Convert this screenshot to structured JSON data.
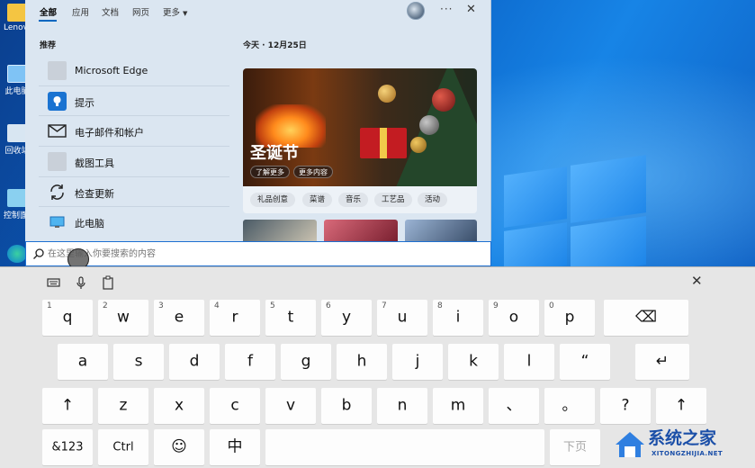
{
  "start": {
    "tabs": [
      {
        "label": "全部",
        "active": true
      },
      {
        "label": "应用"
      },
      {
        "label": "文档"
      },
      {
        "label": "网页"
      },
      {
        "label": "更多"
      }
    ],
    "recommended_title": "推荐",
    "recommended": [
      {
        "label": "Microsoft Edge",
        "icon": "edge-icon"
      },
      {
        "label": "提示",
        "icon": "lightbulb-icon"
      },
      {
        "label": "电子邮件和帐户",
        "icon": "mail-icon"
      },
      {
        "label": "截图工具",
        "icon": "snipping-tool-icon"
      },
      {
        "label": "检查更新",
        "icon": "refresh-icon"
      },
      {
        "label": "此电脑",
        "icon": "computer-icon"
      }
    ],
    "today_label": "今天 · 12月25日",
    "feature": {
      "title": "圣诞节",
      "buttons": [
        "了解更多",
        "更多内容"
      ]
    },
    "tags": [
      "礼品创意",
      "菜谱",
      "音乐",
      "工艺品",
      "活动"
    ]
  },
  "desktop": {
    "icons": [
      {
        "label": "Lenovo",
        "icon": "folder-icon"
      },
      {
        "label": "此电脑",
        "icon": "computer-icon"
      },
      {
        "label": "回收站",
        "icon": "recycle-bin-icon"
      },
      {
        "label": "控制面板",
        "icon": "control-panel-icon"
      },
      {
        "label": "",
        "icon": "edge-icon"
      }
    ]
  },
  "search": {
    "placeholder": "在这里输入你要搜索的内容"
  },
  "keyboard": {
    "rows": [
      [
        {
          "label": "q",
          "sub": "1"
        },
        {
          "label": "w",
          "sub": "2"
        },
        {
          "label": "e",
          "sub": "3"
        },
        {
          "label": "r",
          "sub": "4"
        },
        {
          "label": "t",
          "sub": "5"
        },
        {
          "label": "y",
          "sub": "6"
        },
        {
          "label": "u",
          "sub": "7"
        },
        {
          "label": "i",
          "sub": "8"
        },
        {
          "label": "o",
          "sub": "9"
        },
        {
          "label": "p",
          "sub": "0"
        },
        {
          "label": "⌫",
          "icon": "backspace-icon"
        }
      ],
      [
        {
          "label": "a"
        },
        {
          "label": "s"
        },
        {
          "label": "d"
        },
        {
          "label": "f"
        },
        {
          "label": "g"
        },
        {
          "label": "h"
        },
        {
          "label": "j"
        },
        {
          "label": "k"
        },
        {
          "label": "l"
        },
        {
          "label": "“"
        },
        {
          "label": "↵",
          "icon": "enter-icon"
        }
      ],
      [
        {
          "label": "↑",
          "icon": "shift-icon"
        },
        {
          "label": "z"
        },
        {
          "label": "x"
        },
        {
          "label": "c"
        },
        {
          "label": "v"
        },
        {
          "label": "b"
        },
        {
          "label": "n"
        },
        {
          "label": "m"
        },
        {
          "label": "、"
        },
        {
          "label": "。"
        },
        {
          "label": "?"
        },
        {
          "label": "↑",
          "icon": "shift-icon"
        }
      ],
      [
        {
          "label": "&123"
        },
        {
          "label": "Ctrl"
        },
        {
          "label": "☺",
          "icon": "emoji-icon"
        },
        {
          "label": "中"
        },
        {
          "label": ""
        },
        {
          "label": "下页"
        }
      ]
    ]
  },
  "watermark": {
    "title": "系统之家",
    "subtitle": "XITONGZHIJIA.NET"
  },
  "colors": {
    "accent": "#0067c0",
    "desktop_blue": "#0a62c6",
    "keyboard_bg": "#e6e6e6",
    "watermark_blue": "#1b4fa8"
  }
}
